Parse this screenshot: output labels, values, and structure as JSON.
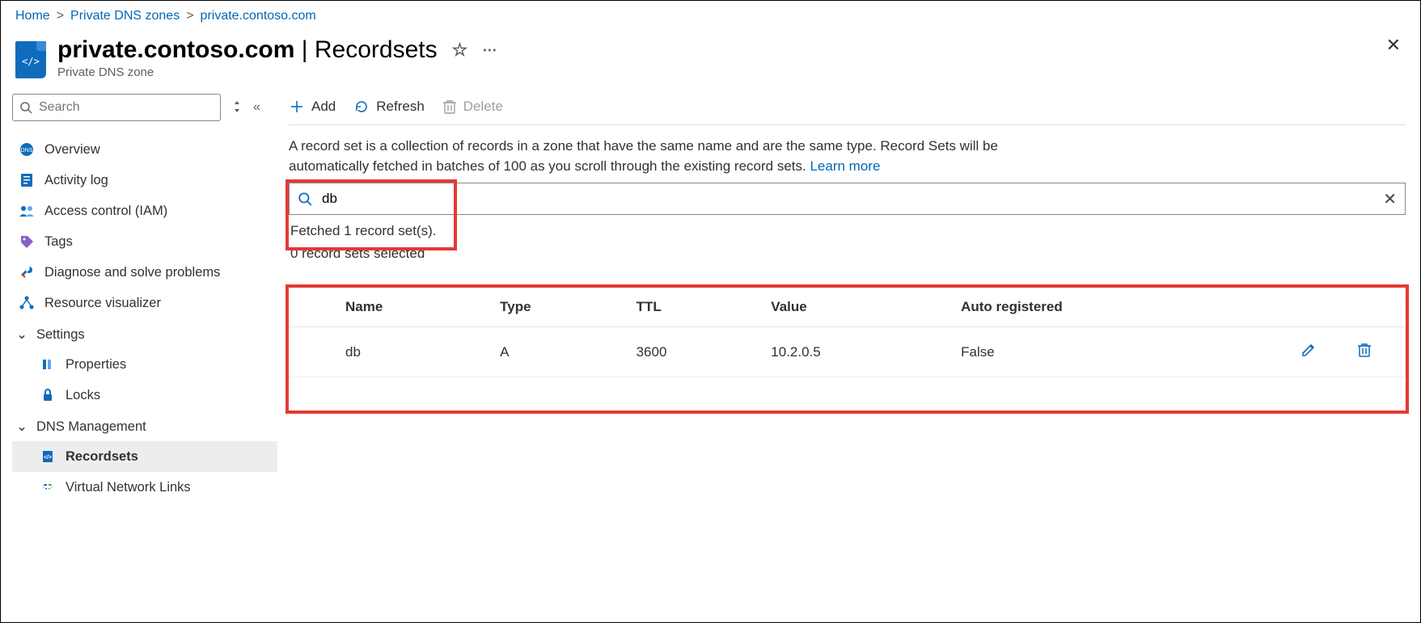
{
  "breadcrumb": {
    "home": "Home",
    "zones": "Private DNS zones",
    "zone": "private.contoso.com"
  },
  "header": {
    "title_main": "private.contoso.com",
    "title_sep": " | ",
    "title_section": "Recordsets",
    "subtitle": "Private DNS zone"
  },
  "sidebar": {
    "search_placeholder": "Search",
    "overview": "Overview",
    "activity": "Activity log",
    "iam": "Access control (IAM)",
    "tags": "Tags",
    "diagnose": "Diagnose and solve problems",
    "resviz": "Resource visualizer",
    "group_settings": "Settings",
    "properties": "Properties",
    "locks": "Locks",
    "group_dns": "DNS Management",
    "recordsets": "Recordsets",
    "vnl": "Virtual Network Links"
  },
  "toolbar": {
    "add": "Add",
    "refresh": "Refresh",
    "delete": "Delete"
  },
  "desc": {
    "text": "A record set is a collection of records in a zone that have the same name and are the same type. Record Sets will be automatically fetched in batches of 100 as you scroll through the existing record sets. ",
    "learn": "Learn more"
  },
  "filter": {
    "value": "db",
    "fetched": "Fetched 1 record set(s).",
    "selected": "0 record sets selected"
  },
  "table": {
    "cols": {
      "name": "Name",
      "type": "Type",
      "ttl": "TTL",
      "value": "Value",
      "auto": "Auto registered"
    },
    "rows": [
      {
        "name": "db",
        "type": "A",
        "ttl": "3600",
        "value": "10.2.0.5",
        "auto": "False"
      }
    ]
  }
}
